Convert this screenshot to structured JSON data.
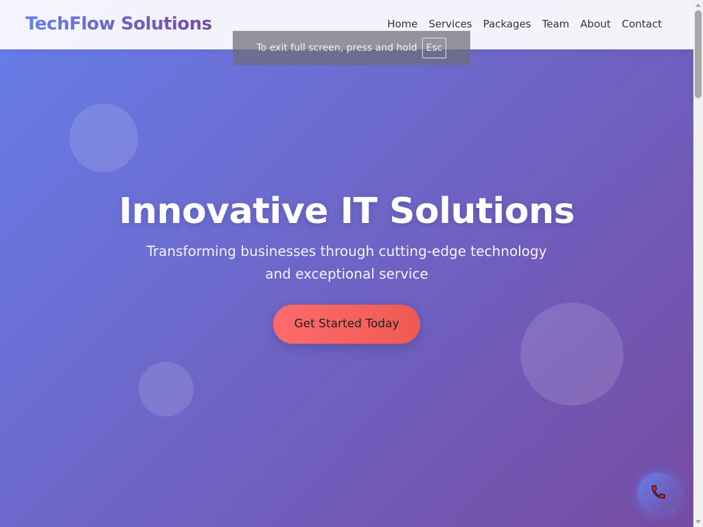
{
  "header": {
    "logo": "TechFlow Solutions",
    "nav": [
      "Home",
      "Services",
      "Packages",
      "Team",
      "About",
      "Contact"
    ]
  },
  "fullscreen_notice": {
    "message": "To exit full screen, press and hold",
    "key": "Esc"
  },
  "hero": {
    "title": "Innovative IT Solutions",
    "subtitle": "Transforming businesses through cutting-edge technology and exceptional service",
    "cta_label": "Get Started Today"
  },
  "floating_button": {
    "icon": "phone-icon"
  },
  "colors": {
    "gradient_start": "#667eea",
    "gradient_end": "#764ba2",
    "cta_start": "#ff6b6b",
    "cta_end": "#ee5a52",
    "header_bg": "#f8f8fc"
  }
}
